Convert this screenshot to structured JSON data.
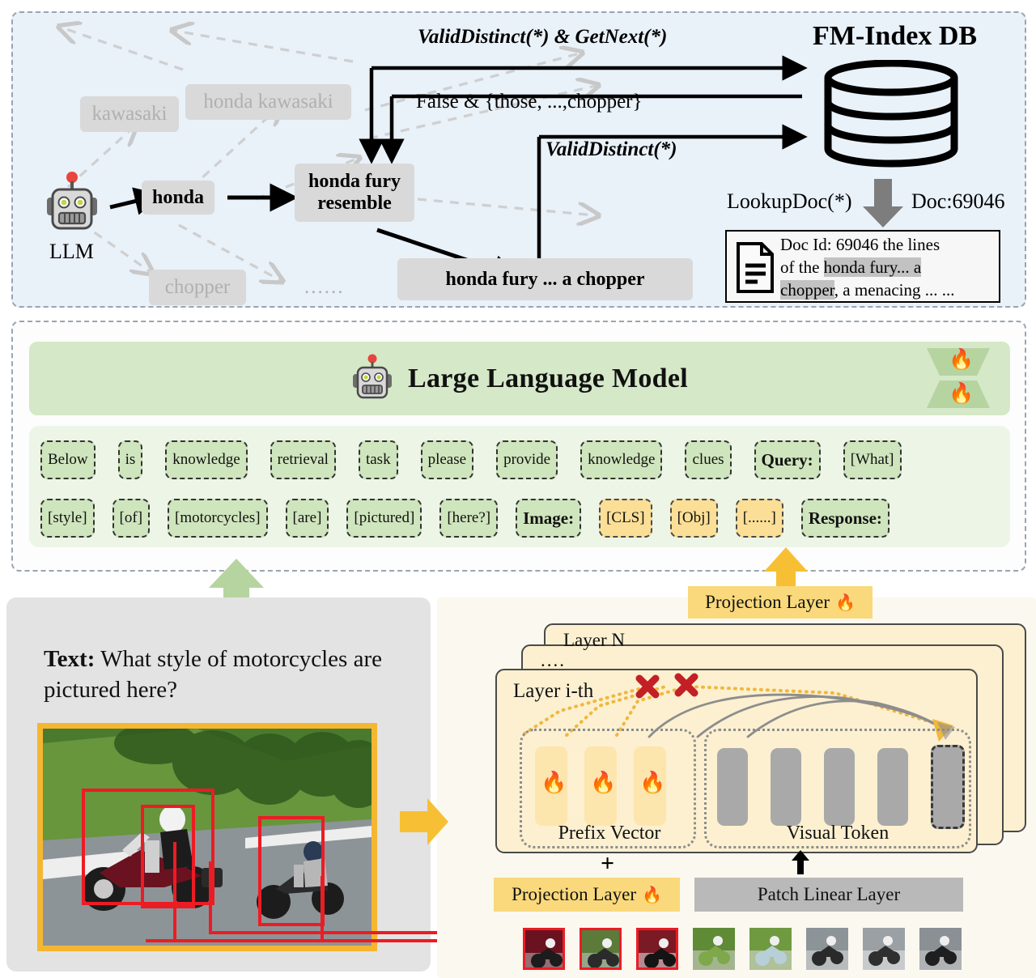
{
  "colors": {
    "panel_retrieval_bg": "#e9f1f9",
    "llm_band_green": "#d5e8c8",
    "token_band_green": "#edf5e6",
    "token_green": "#cfe5bd",
    "token_yellow": "#fbdf96",
    "projection_yellow": "#fad97c",
    "layer_card_bg": "#fcf0d0",
    "prefix_slot": "#fde5ae",
    "visual_slot": "#a9a9a9",
    "patch_linear_gray": "#b9b9b9",
    "photo_frame_orange": "#f5b731",
    "bbox_red": "#ec1c24",
    "gray_chip": "#d9d9d9",
    "faded_text": "#b0b0b0"
  },
  "retrieval": {
    "db_title": "FM-Index DB",
    "db_icon": "database-cylinder-icon",
    "llm_label": "LLM",
    "llm_icon": "robot-icon",
    "beam_candidates": [
      {
        "text": "kawasaki",
        "state": "faded"
      },
      {
        "text": "honda kawasaki",
        "state": "faded"
      },
      {
        "text": "chopper",
        "state": "faded"
      },
      {
        "text": "......",
        "state": "ellipsis"
      }
    ],
    "beam_accepted": [
      {
        "text": "honda",
        "state": "active"
      },
      {
        "text": "honda fury resemble",
        "state": "active"
      },
      {
        "text": "honda fury ...  a chopper",
        "state": "active"
      }
    ],
    "edge_labels": [
      "ValidDistinct(*) & GetNext(*)",
      "False & {those, ...,chopper}",
      "ValidDistinct(*)"
    ],
    "lookup_label": "LookupDoc(*)",
    "doc_id_label": "Doc:69046",
    "doc_icon": "document-icon",
    "doc_lines": [
      {
        "pre": "Doc Id: 69046 the lines",
        "hl": ""
      },
      {
        "pre": "of the ",
        "hl": "honda fury... a"
      },
      {
        "hl": "chopper",
        "post": ", a menacing ... ..."
      }
    ]
  },
  "llm": {
    "title": "Large Language Model",
    "robot_icon": "robot-icon",
    "trainable_icon": "flame-icon",
    "trainable_badges": 2,
    "tokens_row1": [
      {
        "label": "Below",
        "kind": "green",
        "strong": false
      },
      {
        "label": "is",
        "kind": "green",
        "strong": false
      },
      {
        "label": "knowledge",
        "kind": "green",
        "strong": false
      },
      {
        "label": "retrieval",
        "kind": "green",
        "strong": false
      },
      {
        "label": "task",
        "kind": "green",
        "strong": false
      },
      {
        "label": "please",
        "kind": "green",
        "strong": false
      },
      {
        "label": "provide",
        "kind": "green",
        "strong": false
      },
      {
        "label": "knowledge",
        "kind": "green",
        "strong": false
      },
      {
        "label": "clues",
        "kind": "green",
        "strong": false
      },
      {
        "label": "Query:",
        "kind": "green",
        "strong": true
      },
      {
        "label": "[What]",
        "kind": "green",
        "strong": false
      }
    ],
    "tokens_row2": [
      {
        "label": "[style]",
        "kind": "green",
        "strong": false
      },
      {
        "label": "[of]",
        "kind": "green",
        "strong": false
      },
      {
        "label": "[motorcycles]",
        "kind": "green",
        "strong": false
      },
      {
        "label": "[are]",
        "kind": "green",
        "strong": false
      },
      {
        "label": "[pictured]",
        "kind": "green",
        "strong": false
      },
      {
        "label": "[here?]",
        "kind": "green",
        "strong": false
      },
      {
        "label": "Image:",
        "kind": "green",
        "strong": true
      },
      {
        "label": "[CLS]",
        "kind": "yellow",
        "strong": false
      },
      {
        "label": "[Obj]",
        "kind": "yellow",
        "strong": false
      },
      {
        "label": "[......]",
        "kind": "yellow",
        "strong": false
      },
      {
        "label": "Response:",
        "kind": "green",
        "strong": true
      }
    ]
  },
  "input": {
    "text_prefix": "Text:",
    "text_body": "What style of motorcycles are pictured here?",
    "image_name": "two-motorcycles-on-road-photo",
    "bbox_count": 3
  },
  "encoder": {
    "projection_top": {
      "label": "Projection Layer",
      "icon": "flame-icon"
    },
    "projection_bottom": {
      "label": "Projection Layer",
      "icon": "flame-icon"
    },
    "patch_linear": {
      "label": "Patch Linear Layer"
    },
    "layers": [
      {
        "label": "Layer N"
      },
      {
        "label": "...."
      },
      {
        "label": "Layer i-th"
      }
    ],
    "prefix_group_label": "Prefix Vector",
    "visual_group_label": "Visual Token",
    "prefix_slots": 3,
    "prefix_slot_icon": "flame-icon",
    "visual_slots": 5,
    "blocked_marker_icon": "red-cross-icon",
    "blocked_marker_count": 2,
    "plus_marker": "+",
    "patch_count": 8,
    "patch_selected": 3
  }
}
